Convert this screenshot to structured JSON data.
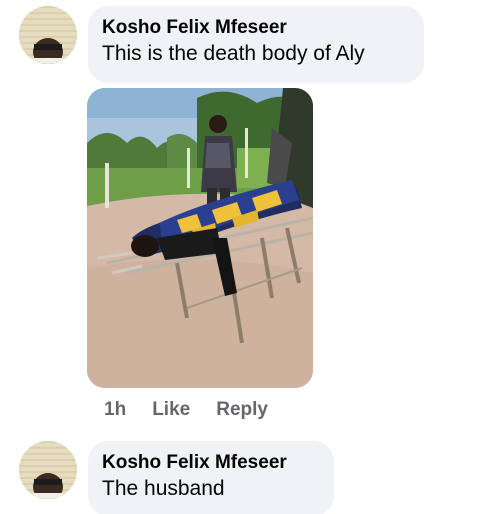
{
  "comments": [
    {
      "author": "Kosho Felix Mfeseer",
      "text": "This is the death body of Aly",
      "actions": {
        "time": "1h",
        "like": "Like",
        "reply": "Reply"
      }
    },
    {
      "author": "Kosho Felix Mfeseer",
      "text": "The husband"
    }
  ],
  "colors": {
    "bubble_bg": "#f0f2f5",
    "action_text": "#65676b",
    "text": "#050505"
  }
}
